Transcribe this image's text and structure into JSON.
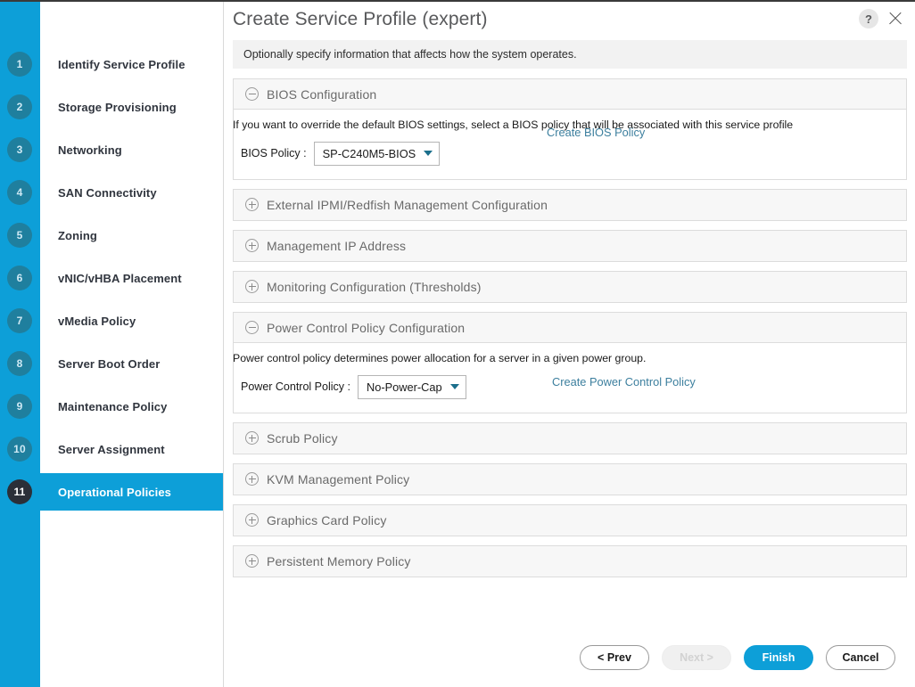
{
  "window": {
    "title": "Create Service Profile (expert)",
    "help_icon": "question-mark-icon",
    "close_icon": "close-icon",
    "info_text": "Optionally specify information that affects how the system operates."
  },
  "colors": {
    "accent_blue": "#0d9fd8",
    "step_badge": "#1f7f9e",
    "active_badge": "#2b2f38",
    "link": "#3c7f9e",
    "section_header_bg": "#f7f7f7",
    "info_bar_bg": "#f2f2f2"
  },
  "sidebar": {
    "steps": [
      {
        "number": "1",
        "label": "Identify Service Profile",
        "active": false
      },
      {
        "number": "2",
        "label": "Storage Provisioning",
        "active": false
      },
      {
        "number": "3",
        "label": "Networking",
        "active": false
      },
      {
        "number": "4",
        "label": "SAN Connectivity",
        "active": false
      },
      {
        "number": "5",
        "label": "Zoning",
        "active": false
      },
      {
        "number": "6",
        "label": "vNIC/vHBA Placement",
        "active": false
      },
      {
        "number": "7",
        "label": "vMedia Policy",
        "active": false
      },
      {
        "number": "8",
        "label": "Server Boot Order",
        "active": false
      },
      {
        "number": "9",
        "label": "Maintenance Policy",
        "active": false
      },
      {
        "number": "10",
        "label": "Server Assignment",
        "active": false
      },
      {
        "number": "11",
        "label": "Operational Policies",
        "active": true
      }
    ]
  },
  "sections": [
    {
      "id": "bios-configuration",
      "title": "BIOS Configuration",
      "expanded": true,
      "toggle_icon": "minus-circle-icon",
      "description": "If you want to override the default BIOS settings, select a BIOS policy that will be associated with this service profile",
      "field_label": "BIOS Policy :",
      "field_value": "SP-C240M5-BIOS",
      "link_label": "Create BIOS Policy"
    },
    {
      "id": "external-ipmi-redfish",
      "title": "External IPMI/Redfish Management Configuration",
      "expanded": false,
      "toggle_icon": "plus-circle-icon"
    },
    {
      "id": "management-ip-address",
      "title": "Management IP Address",
      "expanded": false,
      "toggle_icon": "plus-circle-icon"
    },
    {
      "id": "monitoring-configuration",
      "title": "Monitoring Configuration (Thresholds)",
      "expanded": false,
      "toggle_icon": "plus-circle-icon"
    },
    {
      "id": "power-control-policy",
      "title": "Power Control Policy Configuration",
      "expanded": true,
      "toggle_icon": "minus-circle-icon",
      "description": "Power control policy determines power allocation for a server in a given power group.",
      "field_label": "Power Control Policy :",
      "field_value": "No-Power-Cap",
      "link_label": "Create Power Control Policy"
    },
    {
      "id": "scrub-policy",
      "title": "Scrub Policy",
      "expanded": false,
      "toggle_icon": "plus-circle-icon"
    },
    {
      "id": "kvm-management-policy",
      "title": "KVM Management Policy",
      "expanded": false,
      "toggle_icon": "plus-circle-icon"
    },
    {
      "id": "graphics-card-policy",
      "title": "Graphics Card Policy",
      "expanded": false,
      "toggle_icon": "plus-circle-icon"
    },
    {
      "id": "persistent-memory-policy",
      "title": "Persistent Memory Policy",
      "expanded": false,
      "toggle_icon": "plus-circle-icon"
    }
  ],
  "footer": {
    "prev_label": "< Prev",
    "next_label": "Next >",
    "next_disabled": true,
    "finish_label": "Finish",
    "cancel_label": "Cancel"
  }
}
